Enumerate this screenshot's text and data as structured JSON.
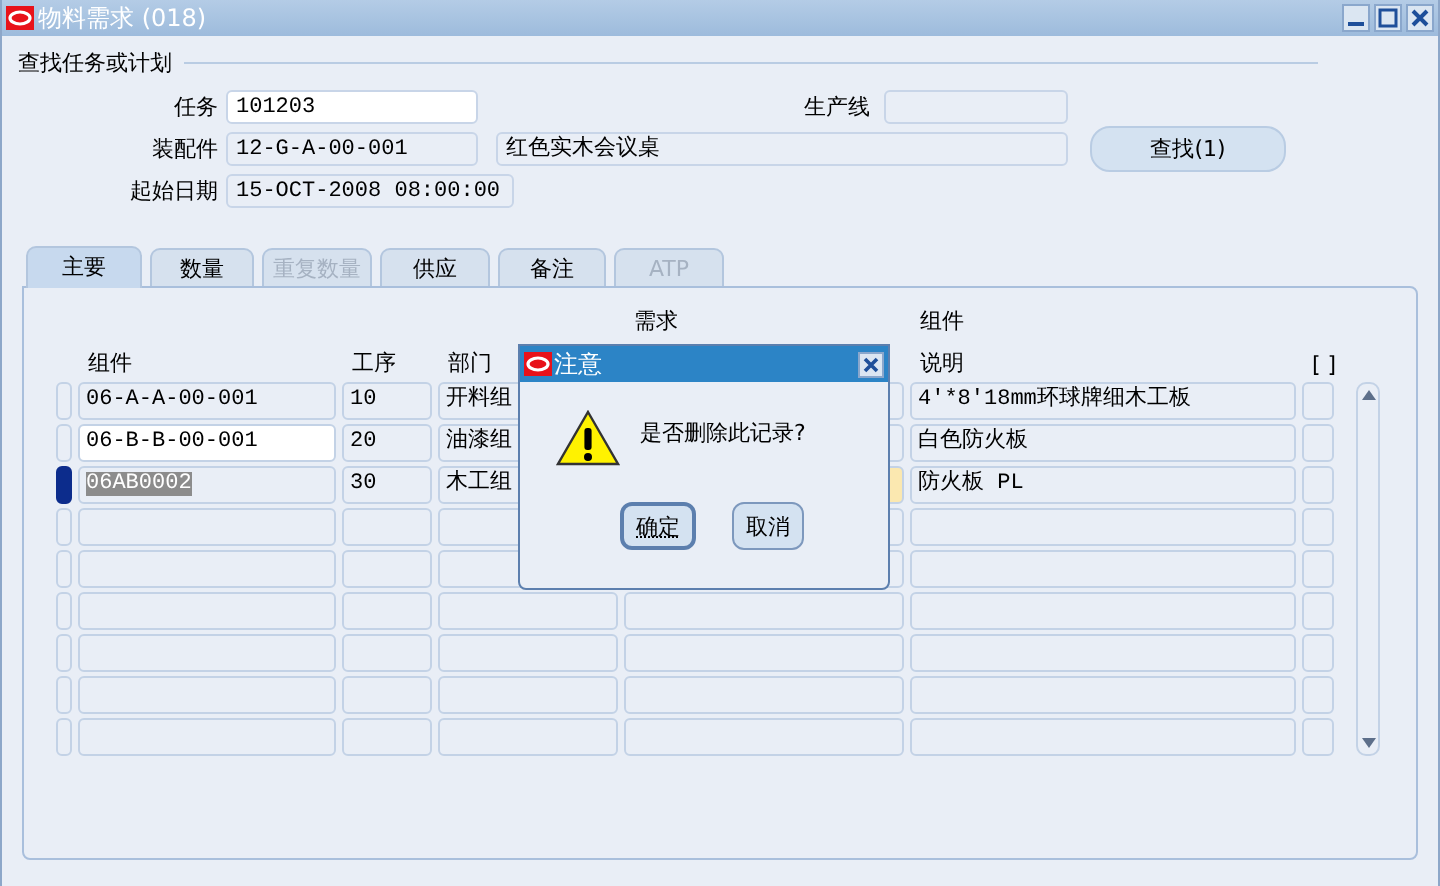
{
  "window": {
    "title": "物料需求 (018)"
  },
  "search_section": {
    "title": "查找任务或计划",
    "job": {
      "label": "任务",
      "value": "101203",
      "editable": true
    },
    "line": {
      "label": "生产线",
      "editable": false
    },
    "assembly": {
      "label": "装配件",
      "value": "12-G-A-00-001",
      "description": "红色实木会议桌",
      "editable": false
    },
    "start_date": {
      "label": "起始日期",
      "value": "15-OCT-2008 08:00:00",
      "editable": false
    },
    "find_button": "查找(1)"
  },
  "tabs": [
    {
      "label": "主要",
      "selected": true,
      "disabled": false
    },
    {
      "label": "数量",
      "selected": false,
      "disabled": false
    },
    {
      "label": "重复数量",
      "selected": false,
      "disabled": true
    },
    {
      "label": "供应",
      "selected": false,
      "disabled": false
    },
    {
      "label": "备注",
      "selected": false,
      "disabled": false
    },
    {
      "label": "ATP",
      "selected": false,
      "disabled": true
    }
  ],
  "table": {
    "columns": [
      {
        "label": "组件"
      },
      {
        "label": "工序"
      },
      {
        "label": "部门"
      },
      {
        "label_top": "需求"
      },
      {
        "label_top": "组件",
        "label": "说明"
      },
      {
        "label": "[ ]"
      }
    ],
    "rows": [
      {
        "selected": false,
        "active": false,
        "required": false,
        "cells": [
          "06-A-A-00-001",
          "10",
          "开料组",
          "4'*8'18mm环球牌细木工板"
        ]
      },
      {
        "selected": false,
        "active": true,
        "required": false,
        "cells": [
          "06-B-B-00-001",
          "20",
          "油漆组",
          "白色防火板"
        ]
      },
      {
        "selected": true,
        "active": false,
        "required": true,
        "cells": [
          "06AB0002",
          "30",
          "木工组",
          "防火板 PL"
        ]
      },
      {
        "selected": false,
        "active": false,
        "required": false
      },
      {
        "selected": false,
        "active": false,
        "required": false
      },
      {
        "selected": false,
        "active": false,
        "required": false
      },
      {
        "selected": false,
        "active": false,
        "required": false
      },
      {
        "selected": false,
        "active": false,
        "required": false
      },
      {
        "selected": false,
        "active": false,
        "required": false
      }
    ]
  },
  "dialog": {
    "title": "注意",
    "message": "是否删除此记录?",
    "buttons": [
      {
        "label": "确定",
        "default": true
      },
      {
        "label": "取消",
        "default": false
      }
    ]
  }
}
